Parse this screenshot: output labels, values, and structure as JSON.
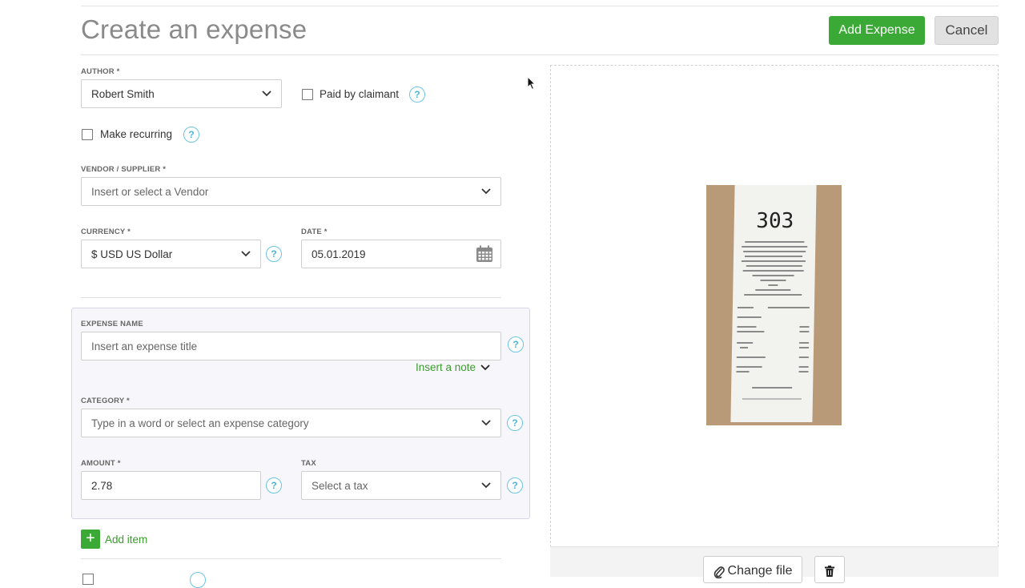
{
  "header": {
    "title": "Create an expense",
    "add_button": "Add Expense",
    "cancel_button": "Cancel"
  },
  "form": {
    "author": {
      "label": "AUTHOR *",
      "value": "Robert Smith"
    },
    "paid_by_claimant": {
      "label": "Paid by claimant",
      "checked": false
    },
    "make_recurring": {
      "label": "Make recurring",
      "checked": false
    },
    "vendor": {
      "label": "VENDOR / SUPPLIER *",
      "placeholder": "Insert or select a Vendor"
    },
    "currency": {
      "label": "CURRENCY *",
      "value": "$ USD US Dollar"
    },
    "date": {
      "label": "DATE *",
      "value": "05.01.2019"
    },
    "expense_name": {
      "label": "EXPENSE NAME",
      "placeholder": "Insert an expense title"
    },
    "insert_note": "Insert a note",
    "category": {
      "label": "CATEGORY *",
      "placeholder": "Type in a word or select an expense category"
    },
    "amount": {
      "label": "AMOUNT *",
      "value": "2.78"
    },
    "tax": {
      "label": "TAX",
      "placeholder": "Select a tax"
    },
    "add_item": "Add item",
    "help_glyph": "?"
  },
  "preview": {
    "receipt_number": "303",
    "change_file": "Change file"
  },
  "colors": {
    "accent_green": "#3aa935",
    "help_blue": "#4eb5dd"
  }
}
